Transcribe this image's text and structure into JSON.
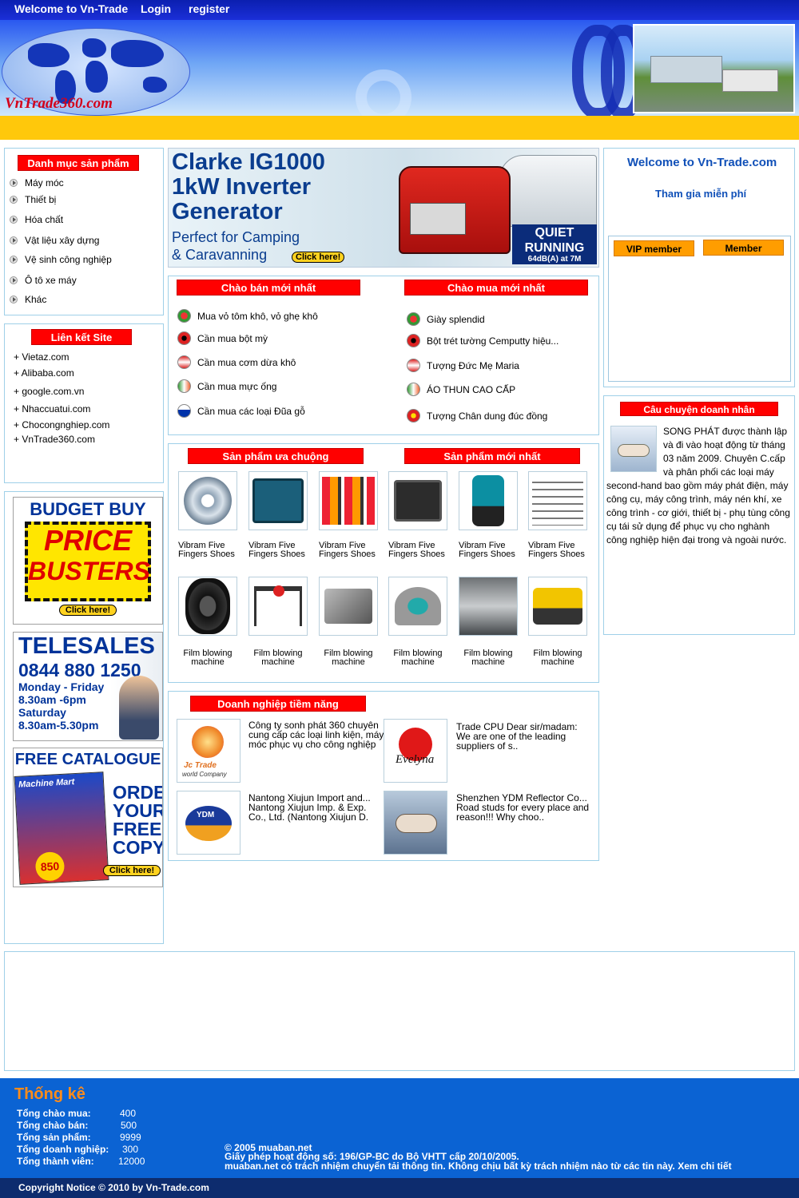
{
  "topbar": {
    "welcome": "Welcome to Vn-Trade",
    "login": "Login",
    "register": "register"
  },
  "banner": {
    "logo": "VnTrade360.com"
  },
  "categories": {
    "title": "Danh mục sản phẩm",
    "items": [
      "Máy móc",
      "Thiết bị",
      "Hóa chất",
      "Vật liệu xây dựng",
      "Vệ sinh công nghiệp",
      "Ô tô xe máy",
      "Khác"
    ]
  },
  "links": {
    "title": "Liên kết Site",
    "items": [
      "+ Vietaz.com",
      "+ Alibaba.com",
      "+ google.com.vn",
      "+ Nhaccuatui.com",
      "+ Chocongnghiep.com",
      "+ VnTrade360.com"
    ]
  },
  "ads": {
    "budget": {
      "line1": "BUDGET BUY",
      "line2": "PRICE",
      "line3": "BUSTERS",
      "cta": "Click here!"
    },
    "telesales": {
      "title": "TELESALES",
      "phone": "0844 880 1250",
      "l1": "Monday - Friday",
      "l2": "8.30am -6pm",
      "l3": "Saturday",
      "l4": "8.30am-5.30pm"
    },
    "catalogue": {
      "title": "FREE CATALOGUE",
      "brand": "Machine Mart",
      "order": "ORDER",
      "your": "YOUR",
      "free": "FREE",
      "copy": "COPY",
      "badge": "850",
      "cta": "Click here!"
    }
  },
  "hero": {
    "line1": "Clarke IG1000",
    "line2": "1kW Inverter",
    "line3": "Generator",
    "line4": "Perfect for Camping",
    "line5": "& Caravanning",
    "cta": "Click here!",
    "quiet1": "QUIET",
    "quiet2": "RUNNING",
    "quiet3": "64dB(A) at 7M"
  },
  "offers": {
    "sell_title": "Chào bán mới nhất",
    "buy_title": "Chào mua mới nhất",
    "sell": [
      "Mua vỏ tôm khô, vỏ ghẹ khô",
      "Cần mua bột mỳ",
      "Cần mua cơm dừa khô",
      "Cần mua mực ống",
      "Cần mua các loại Đũa gỗ"
    ],
    "buy": [
      "Giày splendid",
      "Bột trét tường Cemputty hiệu...",
      "Tượng Đức Mẹ Maria",
      "ÁO THUN CAO CẤP",
      "Tượng Chân dung đúc đồng"
    ]
  },
  "products": {
    "popular_title": "Sản phẩm ưa chuộng",
    "new_title": "Sản phẩm mới nhất",
    "row1": [
      "Vibram Five Fingers Shoes",
      "Vibram Five Fingers Shoes",
      "Vibram Five Fingers Shoes",
      "Vibram Five Fingers Shoes",
      "Vibram Five Fingers Shoes",
      "Vibram Five Fingers Shoes"
    ],
    "row2": [
      "Film blowing machine",
      "Film blowing machine",
      "Film blowing machine",
      "Film blowing machine",
      "Film blowing machine",
      "Film blowing machine"
    ]
  },
  "business": {
    "title": "Doanh nghiệp tiềm năng",
    "items": [
      {
        "logo": "Jc Trade",
        "logo2": "world Company",
        "text": "Công ty sonh phát 360 chuyên cung cấp các loại linh kiện, máy móc phục vụ cho công nghiệp"
      },
      {
        "logo": "Evelyna",
        "text": "Trade CPU Dear sir/madam: We are one of the leading suppliers of s.."
      },
      {
        "logo": "YDM",
        "text": "Nantong Xiujun Import and... Nantong Xiujun Imp. & Exp. Co., Ltd. (Nantong Xiujun D."
      },
      {
        "logo": "",
        "text": "Shenzhen YDM Reflector Co... Road studs for every place and reason!!! Why choo.."
      }
    ]
  },
  "right": {
    "welcome": "Welcome to Vn-Trade.com",
    "join": "Tham gia miễn phí",
    "vip": "VIP member",
    "member": "Member",
    "story_title": "Câu chuyện doanh nhân",
    "story": "SONG PHÁT được thành lập và đi vào hoạt động từ tháng 03 năm 2009. Chuyên C.cấp và phân phối các loại máy second-hand bao gồm máy phát điện, máy công cụ, máy công trình, máy nén khí, xe công trình - cơ giới, thiết bị - phụ tùng công cụ tái sử dụng để phục vụ cho nghành công nghiệp hiện đại trong và ngoài nước."
  },
  "footer": {
    "title": "Thống kê",
    "stats": [
      {
        "label": "Tổng chào mua:",
        "value": "400"
      },
      {
        "label": "Tổng chào bán:",
        "value": "500"
      },
      {
        "label": "Tổng sản phẩm:",
        "value": "9999"
      },
      {
        "label": "Tổng doanh nghiệp:",
        "value": "300"
      },
      {
        "label": "Tổng thành viên:",
        "value": "12000"
      }
    ],
    "copy1": "© 2005 muaban.net",
    "copy2": "Giấy phép hoạt động số: 196/GP-BC do Bộ VHTT cấp 20/10/2005.",
    "copy3": "muaban.net có trách nhiệm chuyển tải thông tin. Không chịu bất kỳ trách nhiệm nào từ các tin này. Xem chi tiết",
    "notice": "Copyright Notice © 2010 by Vn-Trade.com"
  },
  "colors": {
    "topbar": "#0b1fb0",
    "accent_red": "#ff0000",
    "yellow_bar": "#ffc80b",
    "footer": "#0b63d3",
    "link_blue": "#1050b8",
    "orange_tab": "#ff9d00"
  }
}
